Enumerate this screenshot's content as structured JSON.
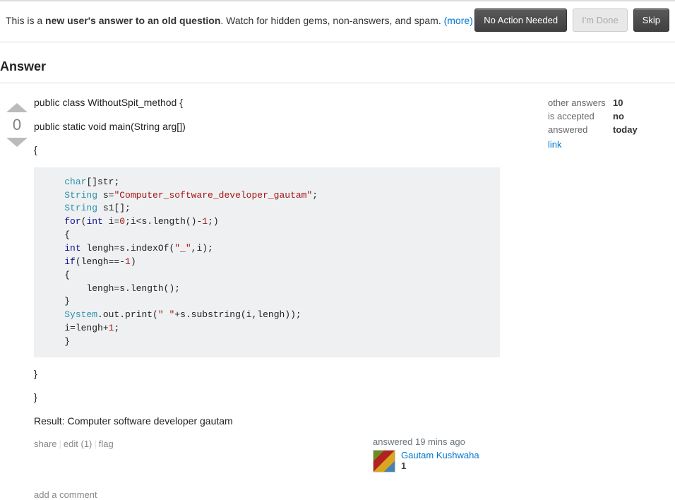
{
  "review": {
    "prefix": "This is a ",
    "bold": "new user's answer to an old question",
    "suffix": ". Watch for hidden gems, non-answers, and spam. ",
    "more": "(more)",
    "buttons": {
      "no_action": "No Action Needed",
      "im_done": "I'm Done",
      "skip": "Skip"
    }
  },
  "section_title": "Answer",
  "vote_score": "0",
  "post": {
    "line1": "public class WithoutSpit_method {",
    "line2": "public static void main(String arg[])",
    "line3": "{",
    "result": "Result: Computer software developer gautam",
    "close1": "}",
    "close2": "}"
  },
  "code": {
    "t_char": "char",
    "r_brackets_str": "[]str;",
    "t_string": "String",
    "r_s_eq": " s=",
    "str_literal": "\"Computer_software_developer_gautam\"",
    "semi": ";",
    "r_s1": " s1[];",
    "kw_for": "for",
    "lparen": "(",
    "t_int": "int",
    "r_i_eq": " i=",
    "n0": "0",
    "r_loopcond": ";i<s.length()-",
    "n1a": "1",
    "r_loopend": ";)",
    "lbrace": "{",
    "r_lengh_eq": " lengh=s.indexOf(",
    "str_underscore": "\"_\"",
    "r_comma_i": ",i);",
    "kw_if": "if",
    "r_lengh_neg": "(lengh==-",
    "n1b": "1",
    "rparen": ")",
    "r_lengh_setlen": "    lengh=s.length();",
    "rbrace": "}",
    "t_system": "System",
    "r_outprint": ".out.print(",
    "str_space": "\" \"",
    "r_plus_sub": "+s.substring(i,lengh));",
    "r_i_set": "i=lengh+",
    "n1c": "1"
  },
  "menu": {
    "share": "share",
    "edit": "edit (1)",
    "flag": "flag"
  },
  "user": {
    "time": "answered 19 mins ago",
    "name": "Gautam Kushwaha",
    "rep": "1"
  },
  "sidebar": {
    "rows": [
      {
        "label": "other answers",
        "value": "10"
      },
      {
        "label": "is accepted",
        "value": "no"
      },
      {
        "label": "answered",
        "value": "today"
      }
    ],
    "link": "link"
  },
  "add_comment": "add a comment"
}
